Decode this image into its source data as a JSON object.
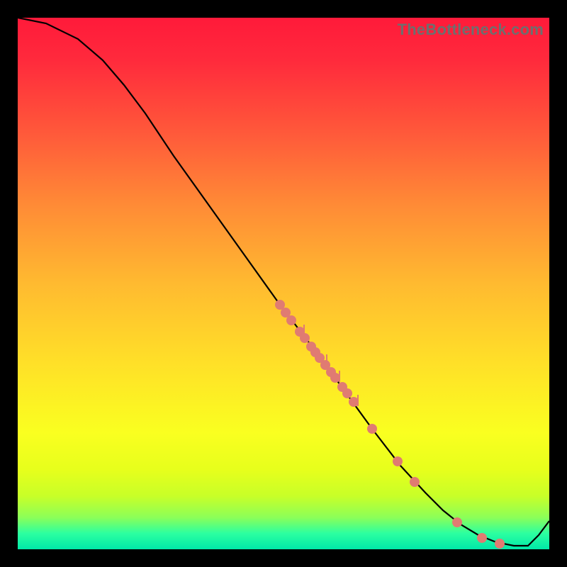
{
  "watermark": "TheBottleneck.com",
  "chart_data": {
    "type": "line",
    "title": "",
    "xlabel": "",
    "ylabel": "",
    "xlim": [
      0,
      750
    ],
    "ylim": [
      0,
      750
    ],
    "curve": [
      [
        0,
        0
      ],
      [
        40,
        8
      ],
      [
        85,
        30
      ],
      [
        120,
        60
      ],
      [
        150,
        95
      ],
      [
        180,
        135
      ],
      [
        220,
        195
      ],
      [
        270,
        265
      ],
      [
        320,
        335
      ],
      [
        370,
        405
      ],
      [
        420,
        470
      ],
      [
        460,
        525
      ],
      [
        500,
        580
      ],
      [
        540,
        632
      ],
      [
        575,
        670
      ],
      [
        600,
        695
      ],
      [
        625,
        715
      ],
      [
        650,
        730
      ],
      [
        675,
        740
      ],
      [
        700,
        745
      ],
      [
        720,
        745
      ],
      [
        735,
        730
      ],
      [
        750,
        710
      ]
    ],
    "markers": [
      [
        370,
        405
      ],
      [
        378,
        416
      ],
      [
        386,
        427
      ],
      [
        398,
        443
      ],
      [
        405,
        452
      ],
      [
        414,
        464
      ],
      [
        420,
        472
      ],
      [
        426,
        480
      ],
      [
        434,
        490
      ],
      [
        442,
        500
      ],
      [
        448,
        508
      ],
      [
        458,
        521
      ],
      [
        465,
        530
      ],
      [
        474,
        542
      ],
      [
        500,
        580
      ],
      [
        536,
        626
      ],
      [
        560,
        655
      ],
      [
        620,
        712
      ],
      [
        655,
        734
      ],
      [
        680,
        742
      ]
    ],
    "marker_ticks": [
      [
        398,
        443
      ],
      [
        430,
        485
      ],
      [
        448,
        508
      ],
      [
        474,
        542
      ]
    ]
  }
}
